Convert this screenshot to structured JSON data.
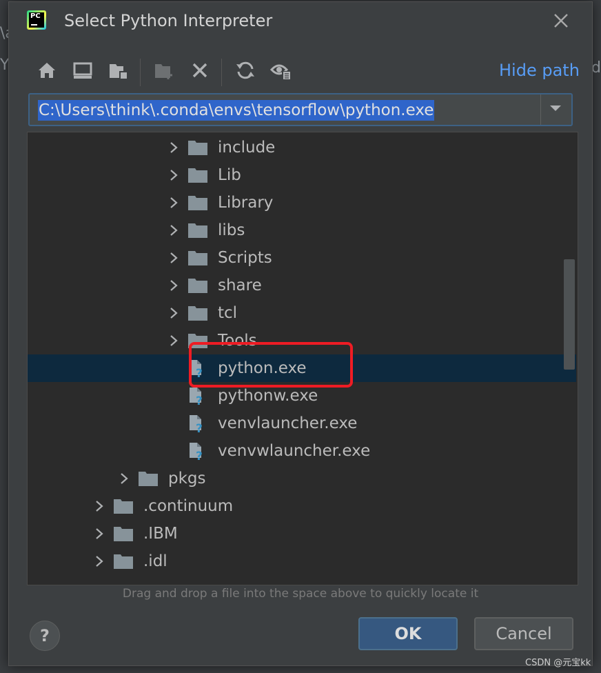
{
  "background": {
    "frag1": "\\a",
    "frag2": "Y",
    "frag3": "d"
  },
  "dialog": {
    "title": "Select Python Interpreter",
    "logo_text": "PC"
  },
  "toolbar": {
    "buttons": [
      "home-icon",
      "desktop-icon",
      "project-folder-icon",
      "new-folder-icon",
      "delete-icon",
      "refresh-icon",
      "show-hidden-icon"
    ],
    "hide_path_label": "Hide path"
  },
  "path": {
    "value": "C:\\Users\\think\\.conda\\envs\\tensorflow\\python.exe"
  },
  "tree": {
    "items": [
      {
        "label": "include",
        "type": "folder",
        "expandable": true
      },
      {
        "label": "Lib",
        "type": "folder",
        "expandable": true
      },
      {
        "label": "Library",
        "type": "folder",
        "expandable": true
      },
      {
        "label": "libs",
        "type": "folder",
        "expandable": true
      },
      {
        "label": "Scripts",
        "type": "folder",
        "expandable": true
      },
      {
        "label": "share",
        "type": "folder",
        "expandable": true
      },
      {
        "label": "tcl",
        "type": "folder",
        "expandable": true
      },
      {
        "label": "Tools",
        "type": "folder",
        "expandable": true
      },
      {
        "label": "python.exe",
        "type": "file",
        "expandable": false,
        "selected": true
      },
      {
        "label": "pythonw.exe",
        "type": "file",
        "expandable": false
      },
      {
        "label": "venvlauncher.exe",
        "type": "file",
        "expandable": false
      },
      {
        "label": "venvwlauncher.exe",
        "type": "file",
        "expandable": false
      },
      {
        "label": "pkgs",
        "type": "folder",
        "expandable": true
      },
      {
        "label": ".continuum",
        "type": "folder",
        "expandable": true
      },
      {
        "label": ".IBM",
        "type": "folder",
        "expandable": true
      },
      {
        "label": ".idl",
        "type": "folder",
        "expandable": true
      }
    ]
  },
  "hint": "Drag and drop a file into the space above to quickly locate it",
  "buttons": {
    "help": "?",
    "ok": "OK",
    "cancel": "Cancel"
  },
  "watermark": "CSDN @元宝kk",
  "colors": {
    "selection": "#0d293e",
    "accent": "#589df6",
    "highlight_box": "#ee1c24"
  }
}
